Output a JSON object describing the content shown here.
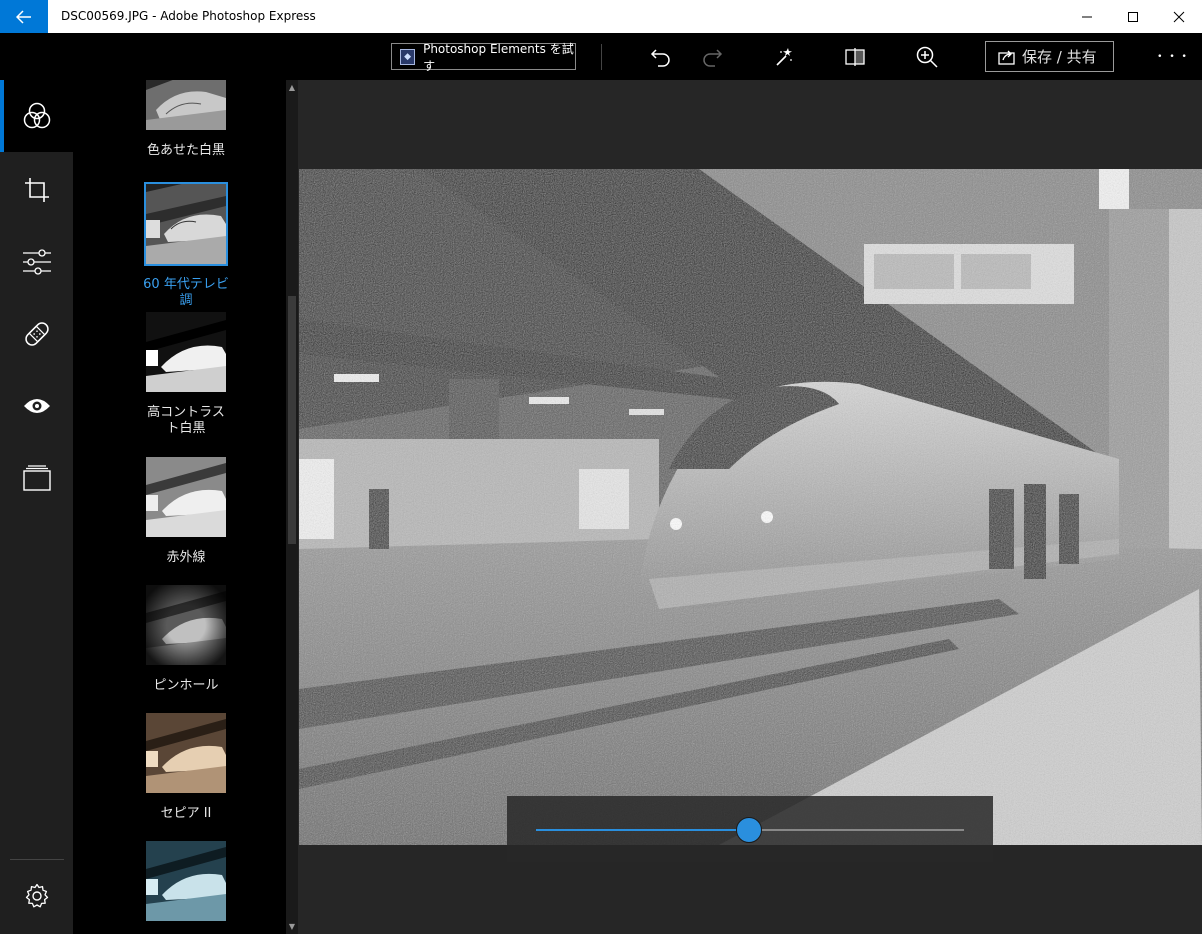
{
  "window": {
    "title": "DSC00569.JPG - Adobe Photoshop Express"
  },
  "toolbar": {
    "pse_label": "Photoshop Elements を試す",
    "save_label": "保存 / 共有",
    "more_label": "• • •"
  },
  "filters": [
    {
      "label": "色あせた白黒",
      "tone": "bw"
    },
    {
      "label": "60 年代テレビ調",
      "tone": "tv",
      "selected": true
    },
    {
      "label": "高コントラスト白黒",
      "tone": "hc"
    },
    {
      "label": "赤外線",
      "tone": "ir"
    },
    {
      "label": "ピンホール",
      "tone": "pin"
    },
    {
      "label": "セピア II",
      "tone": "sepia"
    },
    {
      "label": "",
      "tone": "cyan"
    }
  ],
  "slider": {
    "value": 0.5
  }
}
